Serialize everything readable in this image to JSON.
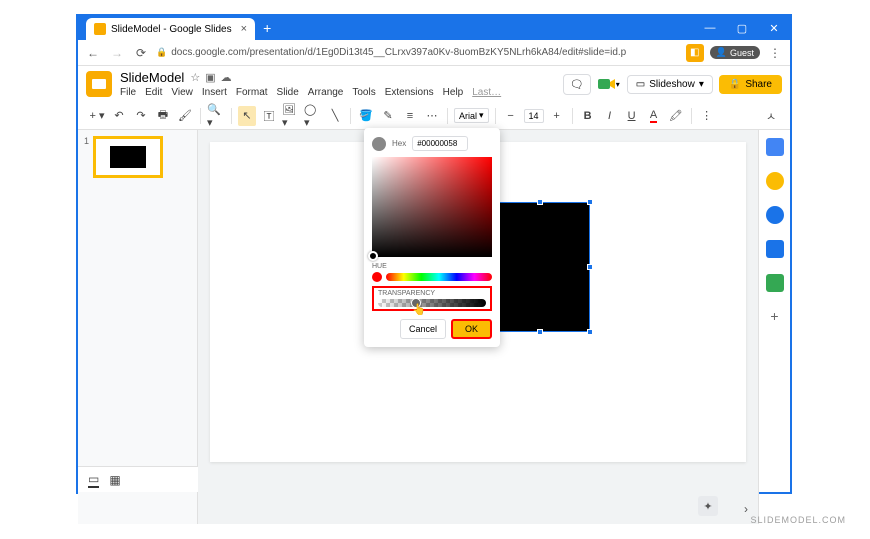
{
  "browser": {
    "tab_title": "SlideModel - Google Slides",
    "url": "docs.google.com/presentation/d/1Eg0Di13t45__CLrxv397a0Kv-8uomBzKY5NLrh6kA84/edit#slide=id.p",
    "guest_label": "Guest"
  },
  "app": {
    "doc_title": "SlideModel",
    "menus": [
      "File",
      "Edit",
      "View",
      "Insert",
      "Format",
      "Slide",
      "Arrange",
      "Tools",
      "Extensions",
      "Help"
    ],
    "last_edit": "Last…",
    "slideshow_label": "Slideshow",
    "share_label": "Share"
  },
  "toolbar": {
    "font": "Arial",
    "font_size": "14"
  },
  "slidepanel": {
    "slide_number": "1"
  },
  "colorpicker": {
    "hex_label": "Hex",
    "hex_value": "#00000058",
    "hue_label": "HUE",
    "transparency_label": "TRANSPARENCY",
    "cancel": "Cancel",
    "ok": "OK"
  },
  "watermark": "SLIDEMODEL.COM"
}
